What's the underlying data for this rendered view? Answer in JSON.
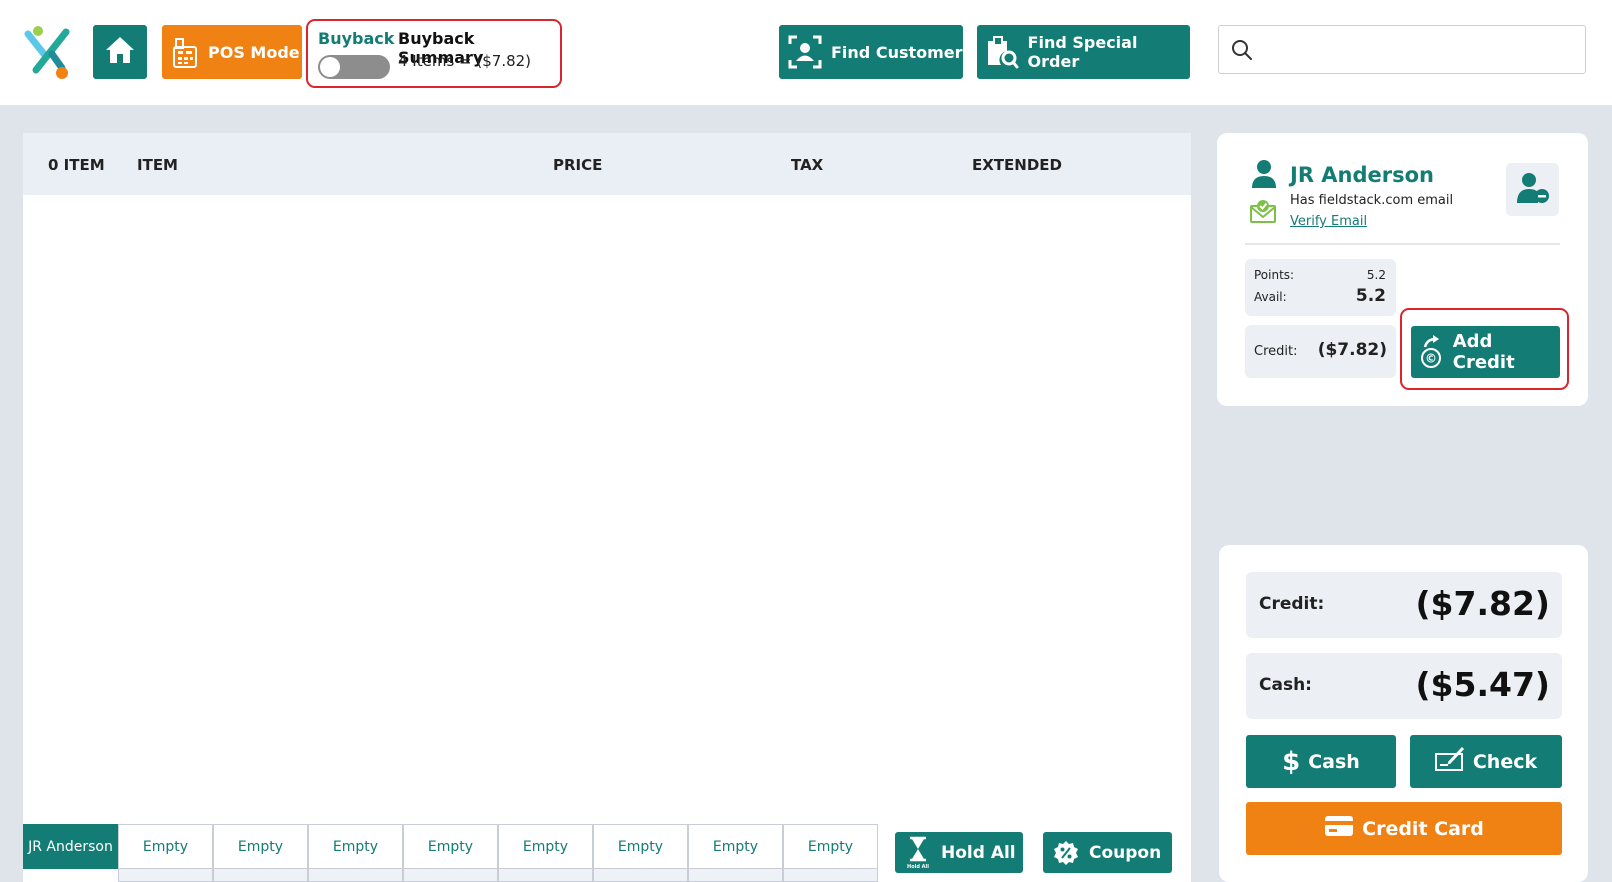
{
  "topbar": {
    "pos_mode_label": "POS Mode",
    "buyback": {
      "toggle_label": "Buyback",
      "toggle_on": false,
      "summary_title": "Buyback Summary",
      "summary_text": "4 Items = ($7.82)"
    },
    "find_customer_label": "Find Customer",
    "find_special_order_label": "Find Special Order",
    "search": {
      "value": "",
      "placeholder": ""
    }
  },
  "cart": {
    "columns": [
      "0 ITEM",
      "ITEM",
      "PRICE",
      "TAX",
      "EXTENDED"
    ],
    "tabs": [
      "JR Anderson",
      "Empty",
      "Empty",
      "Empty",
      "Empty",
      "Empty",
      "Empty",
      "Empty",
      "Empty"
    ],
    "active_tab": 0,
    "hold_all_label": "Hold All",
    "hold_all_icon_caption": "Hold All",
    "coupon_label": "Coupon"
  },
  "customer": {
    "name": "JR Anderson",
    "email_status": "Has fieldstack.com email",
    "verify_link": "Verify Email",
    "points_label": "Points:",
    "points_value": "5.2",
    "avail_label": "Avail:",
    "avail_value": "5.2",
    "credit_label": "Credit:",
    "credit_value": "($7.82)",
    "add_credit_label": "Add Credit"
  },
  "payment": {
    "credit_label": "Credit:",
    "credit_value": "($7.82)",
    "cash_label": "Cash:",
    "cash_value": "($5.47)",
    "cash_button": "Cash",
    "check_button": "Check",
    "credit_card_button": "Credit Card"
  },
  "colors": {
    "teal": "#137c74",
    "orange": "#f08214",
    "highlight_red": "#d9262c",
    "background": "#dfe3ea"
  },
  "icons": [
    "app-logo-icon",
    "home-icon",
    "pos-terminal-icon",
    "find-customer-icon",
    "find-order-icon",
    "search-icon",
    "person-icon",
    "remove-customer-icon",
    "verified-email-icon",
    "add-credit-icon",
    "hourglass-icon",
    "coupon-icon",
    "dollar-icon",
    "check-icon",
    "credit-card-icon"
  ]
}
